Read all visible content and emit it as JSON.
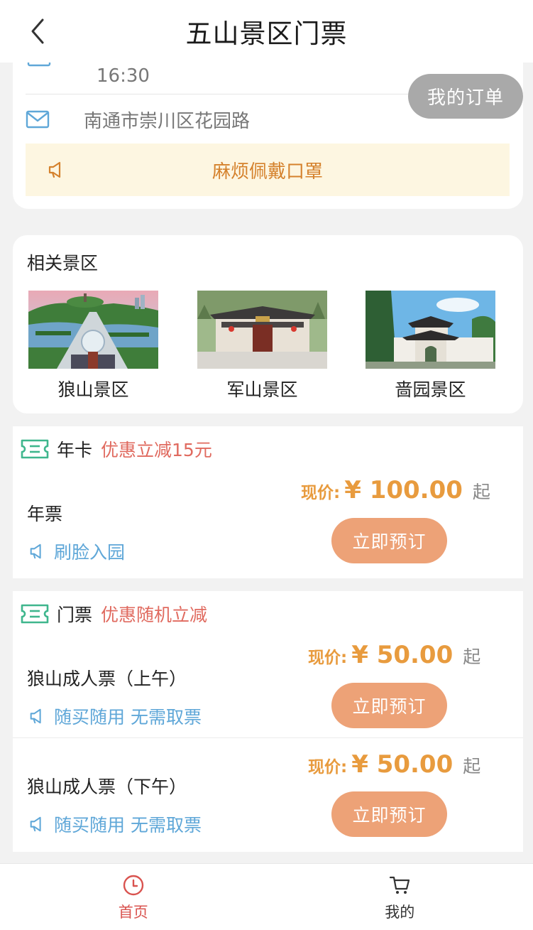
{
  "header": {
    "title": "五山景区门票"
  },
  "floating": {
    "my_order": "我的订单"
  },
  "info": {
    "time": "16:30",
    "address": "南通市崇川区花园路",
    "notice": "麻烦佩戴口罩"
  },
  "related": {
    "title": "相关景区",
    "items": [
      {
        "name": "狼山景区"
      },
      {
        "name": "军山景区"
      },
      {
        "name": "啬园景区"
      }
    ]
  },
  "ticket_groups": [
    {
      "name": "年卡",
      "promo": "优惠立减15元",
      "items": [
        {
          "name": "年票",
          "tag": "刷脸入园",
          "price_label": "现价:",
          "price": "¥ 100.00",
          "suffix": "起",
          "button": "立即预订"
        }
      ]
    },
    {
      "name": "门票",
      "promo": "优惠随机立减",
      "items": [
        {
          "name": "狼山成人票（上午）",
          "tag": "随买随用 无需取票",
          "price_label": "现价:",
          "price": "¥ 50.00",
          "suffix": "起",
          "button": "立即预订"
        },
        {
          "name": "狼山成人票（下午）",
          "tag": "随买随用 无需取票",
          "price_label": "现价:",
          "price": "¥ 50.00",
          "suffix": "起",
          "button": "立即预订"
        }
      ]
    }
  ],
  "nav": {
    "items": [
      {
        "label": "首页",
        "icon": "clock-icon",
        "active": true
      },
      {
        "label": "我的",
        "icon": "cart-icon",
        "active": false
      }
    ]
  },
  "colors": {
    "accent": "#d9534f",
    "price": "#e89b3e",
    "button": "#eda277",
    "tag": "#5fa7d8",
    "notice_bg": "#fdf6e1"
  }
}
